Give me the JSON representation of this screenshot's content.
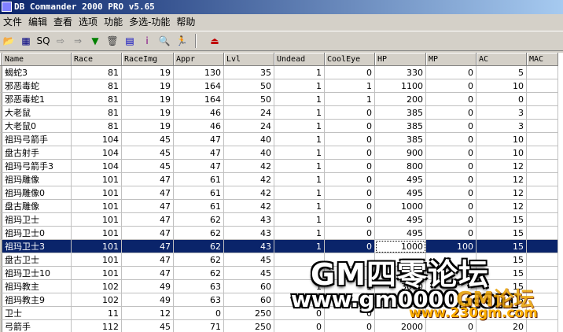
{
  "window": {
    "title": "DB Commander 2000 PRO v5.65"
  },
  "menu": [
    "文件",
    "编辑",
    "查看",
    "选项",
    "功能",
    "多选-功能",
    "帮助"
  ],
  "toolbar": [
    {
      "name": "open-folder-icon",
      "glyph": "📂",
      "color": "#c08000"
    },
    {
      "name": "table-icon",
      "glyph": "▦",
      "color": "#000080"
    },
    {
      "name": "sql-icon",
      "glyph": "SQ",
      "color": "#000000"
    },
    {
      "name": "arrow-right-icon",
      "glyph": "⇨",
      "color": "#808080"
    },
    {
      "name": "export-icon",
      "glyph": "⇒",
      "color": "#808080"
    },
    {
      "name": "filter-icon",
      "glyph": "▼",
      "color": "#008000"
    },
    {
      "name": "trash-icon",
      "glyph": "🗑",
      "color": "#404040"
    },
    {
      "name": "database-icon",
      "glyph": "▤",
      "color": "#0000c0"
    },
    {
      "name": "info-icon",
      "glyph": "i",
      "color": "#800080"
    },
    {
      "name": "search-key-icon",
      "glyph": "🔍",
      "color": "#008080"
    },
    {
      "name": "run-icon",
      "glyph": "🏃",
      "color": "#008000"
    },
    {
      "name": "exit-icon",
      "glyph": "⏏",
      "color": "#c00000"
    }
  ],
  "table": {
    "columns": [
      "Name",
      "Race",
      "RaceImg",
      "Appr",
      "Lvl",
      "Undead",
      "CoolEye",
      "HP",
      "MP",
      "AC",
      "MAC"
    ],
    "rows": [
      [
        "蝎蛇3",
        "81",
        "19",
        "130",
        "35",
        "1",
        "0",
        "330",
        "0",
        "5",
        ""
      ],
      [
        "邪恶毒蛇",
        "81",
        "19",
        "164",
        "50",
        "1",
        "1",
        "1100",
        "0",
        "10",
        ""
      ],
      [
        "邪恶毒蛇1",
        "81",
        "19",
        "164",
        "50",
        "1",
        "1",
        "200",
        "0",
        "0",
        ""
      ],
      [
        "大老鼠",
        "81",
        "19",
        "46",
        "24",
        "1",
        "0",
        "385",
        "0",
        "3",
        ""
      ],
      [
        "大老鼠0",
        "81",
        "19",
        "46",
        "24",
        "1",
        "0",
        "385",
        "0",
        "3",
        ""
      ],
      [
        "祖玛弓箭手",
        "104",
        "45",
        "47",
        "40",
        "1",
        "0",
        "385",
        "0",
        "10",
        ""
      ],
      [
        "盘古射手",
        "104",
        "45",
        "47",
        "40",
        "1",
        "0",
        "900",
        "0",
        "10",
        ""
      ],
      [
        "祖玛弓箭手3",
        "104",
        "45",
        "47",
        "42",
        "1",
        "0",
        "800",
        "0",
        "12",
        ""
      ],
      [
        "祖玛雕像",
        "101",
        "47",
        "61",
        "42",
        "1",
        "0",
        "495",
        "0",
        "12",
        ""
      ],
      [
        "祖玛雕像0",
        "101",
        "47",
        "61",
        "42",
        "1",
        "0",
        "495",
        "0",
        "12",
        ""
      ],
      [
        "盘古雕像",
        "101",
        "47",
        "61",
        "42",
        "1",
        "0",
        "1000",
        "0",
        "12",
        ""
      ],
      [
        "祖玛卫士",
        "101",
        "47",
        "62",
        "43",
        "1",
        "0",
        "495",
        "0",
        "15",
        ""
      ],
      [
        "祖玛卫士0",
        "101",
        "47",
        "62",
        "43",
        "1",
        "0",
        "495",
        "0",
        "15",
        ""
      ],
      [
        "祖玛卫士3",
        "101",
        "47",
        "62",
        "43",
        "1",
        "0",
        "1000",
        "100",
        "15",
        ""
      ],
      [
        "盘古卫士",
        "101",
        "47",
        "62",
        "45",
        "",
        "",
        "",
        "",
        "15",
        ""
      ],
      [
        "祖玛卫士10",
        "101",
        "47",
        "62",
        "45",
        "",
        "",
        "",
        "",
        "15",
        ""
      ],
      [
        "祖玛教主",
        "102",
        "49",
        "63",
        "60",
        "1",
        "1",
        "3000",
        "",
        "15",
        ""
      ],
      [
        "祖玛教主9",
        "102",
        "49",
        "63",
        "60",
        "",
        "",
        "",
        "",
        "25",
        ""
      ],
      [
        "卫士",
        "11",
        "12",
        "0",
        "250",
        "0",
        "0",
        "9",
        "",
        "20",
        ""
      ],
      [
        "弓箭手",
        "112",
        "45",
        "71",
        "250",
        "0",
        "0",
        "2000",
        "0",
        "20",
        ""
      ]
    ],
    "selected_row": 13
  },
  "watermark": {
    "line1": "GM四零论坛",
    "line2": "www.gm0000.com",
    "line3": "GM论坛",
    "line4": "www.230gm.com"
  }
}
